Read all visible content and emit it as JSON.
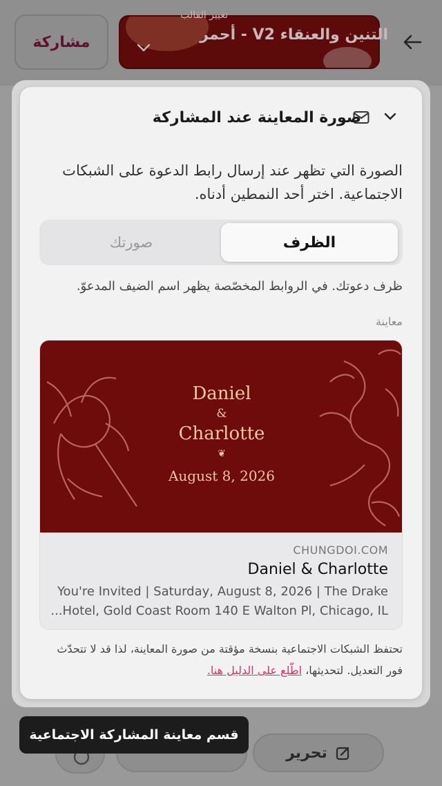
{
  "topbar": {
    "share_label": "مشاركة",
    "template_caption": "تغيير القالب",
    "template_name": "التنين والعنقاء V2 - أحمر"
  },
  "bottom": {
    "edit_label": "تحرير"
  },
  "modal": {
    "title": "صورة المعاينة عند المشاركة",
    "description": "الصورة التي تظهر عند إرسال رابط الدعوة على الشبكات الاجتماعية. اختر أحد النمطين أدناه.",
    "segment_envelope": "الظرف",
    "segment_photo": "صورتك",
    "hint": "ظرف دعوتك. في الروابط المخصّصة يظهر اسم الضيف المدعوّ.",
    "preview_label": "معاينة",
    "footer_text": "تحتفظ الشبكات الاجتماعية بنسخة مؤقتة من صورة المعاينة، لذا قد لا تتحدّث فور التعديل. لتحديثها، ",
    "footer_link": "اطّلع على الدليل هنا."
  },
  "card": {
    "name1": "Daniel",
    "amp": "&",
    "name2": "Charlotte",
    "ornament": "❦",
    "date": "August 8, 2026",
    "domain": "CHUNGDOI.COM",
    "title": "Daniel & Charlotte",
    "description_line1": "You're Invited | Saturday, August 8, 2026 | The Drake",
    "description_line2": "...Hotel, Gold Coast Room 140 E Walton Pl, Chicago, IL"
  },
  "tooltip": {
    "text": "قسم معاينة المشاركة الاجتماعية"
  },
  "colors": {
    "accent": "#d6336c",
    "card_red": "#6e0b0b",
    "card_gold": "#f0c9a0"
  },
  "icons": {
    "back": "arrow-left-icon",
    "chevron": "chevron-down-icon",
    "mail": "mail-icon",
    "edit": "edit-icon",
    "gear": "gear-icon"
  }
}
